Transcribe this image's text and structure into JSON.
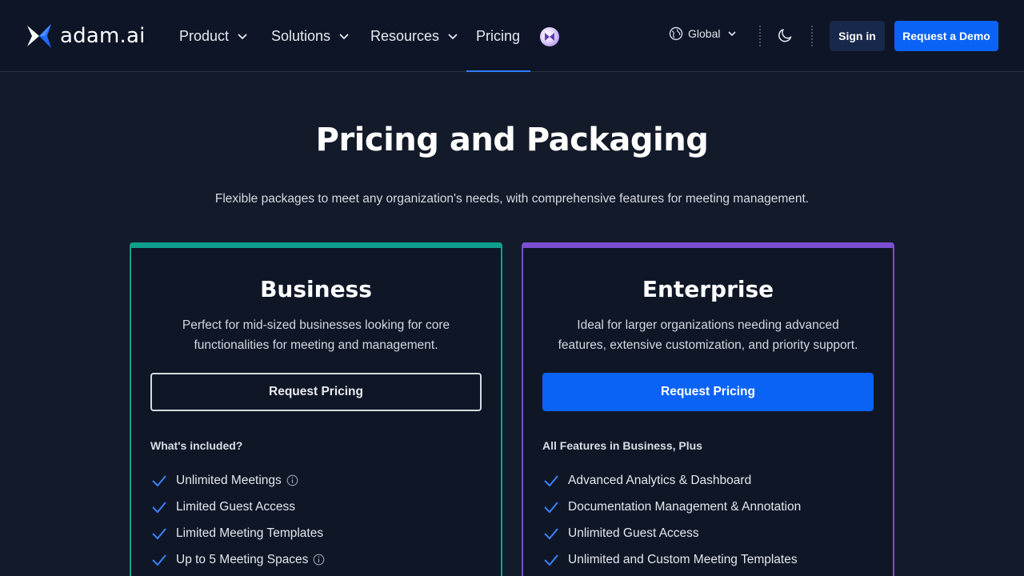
{
  "brand": {
    "name": "adam.ai",
    "logo_icon": "adam-logo-icon"
  },
  "nav": {
    "items": [
      {
        "label": "Product",
        "has_dropdown": true
      },
      {
        "label": "Solutions",
        "has_dropdown": true
      },
      {
        "label": "Resources",
        "has_dropdown": true
      },
      {
        "label": "Pricing",
        "has_dropdown": false,
        "active": true
      }
    ],
    "ai_badge_icon": "ai-assistant-icon"
  },
  "header": {
    "region_label": "Global",
    "theme_icon": "moon-icon",
    "signin_label": "Sign in",
    "demo_label": "Request a Demo"
  },
  "hero": {
    "title": "Pricing and Packaging",
    "subtitle": "Flexible packages to meet any organization's needs, with comprehensive features for meeting management."
  },
  "plans": [
    {
      "name": "Business",
      "description": "Perfect for mid-sized businesses looking for core functionalities for meeting and management.",
      "cta": "Request Pricing",
      "section_label": "What's included?",
      "accent": "#0e9f8c",
      "features": [
        {
          "label": "Unlimited Meetings",
          "info": true
        },
        {
          "label": "Limited Guest Access",
          "info": false
        },
        {
          "label": "Limited Meeting Templates",
          "info": false
        },
        {
          "label": "Up to 5 Meeting Spaces",
          "info": true
        }
      ]
    },
    {
      "name": "Enterprise",
      "description": "Ideal for larger organizations needing advanced features, extensive customization, and priority support.",
      "cta": "Request Pricing",
      "section_label": "All Features in Business, Plus",
      "accent": "#7a4fd1",
      "features": [
        {
          "label": "Advanced Analytics & Dashboard",
          "info": false
        },
        {
          "label": "Documentation Management & Annotation",
          "info": false
        },
        {
          "label": "Unlimited Guest Access",
          "info": false
        },
        {
          "label": "Unlimited and Custom Meeting Templates",
          "info": false
        }
      ]
    }
  ],
  "colors": {
    "background": "#131a2a",
    "header_bg": "#0d1526",
    "primary_blue": "#0b63f6",
    "check_blue": "#3b82f6"
  }
}
